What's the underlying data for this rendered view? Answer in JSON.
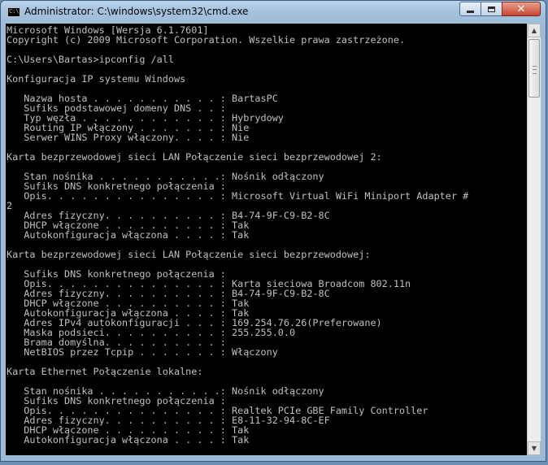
{
  "window": {
    "title": "Administrator: C:\\windows\\system32\\cmd.exe",
    "icon_text": "C:\\"
  },
  "console": {
    "lines": [
      "Microsoft Windows [Wersja 6.1.7601]",
      "Copyright (c) 2009 Microsoft Corporation. Wszelkie prawa zastrzeżone.",
      "",
      "C:\\Users\\Bartas>ipconfig /all",
      "",
      "Konfiguracja IP systemu Windows",
      "",
      "   Nazwa hosta . . . . . . . . . . . : BartasPC",
      "   Sufiks podstawowej domeny DNS . . :",
      "   Typ węzła . . . . . . . . . . . . : Hybrydowy",
      "   Routing IP włączony . . . . . . . : Nie",
      "   Serwer WINS Proxy włączony. . . . : Nie",
      "",
      "Karta bezprzewodowej sieci LAN Połączenie sieci bezprzewodowej 2:",
      "",
      "   Stan nośnika . . . . . . . . . . .: Nośnik odłączony",
      "   Sufiks DNS konkretnego połączenia :",
      "   Opis. . . . . . . . . . . . . . . : Microsoft Virtual WiFi Miniport Adapter #",
      "2",
      "   Adres fizyczny. . . . . . . . . . : B4-74-9F-C9-B2-8C",
      "   DHCP włączone . . . . . . . . . . : Tak",
      "   Autokonfiguracja włączona . . . . : Tak",
      "",
      "Karta bezprzewodowej sieci LAN Połączenie sieci bezprzewodowej:",
      "",
      "   Sufiks DNS konkretnego połączenia :",
      "   Opis. . . . . . . . . . . . . . . : Karta sieciowa Broadcom 802.11n",
      "   Adres fizyczny. . . . . . . . . . : B4-74-9F-C9-B2-8C",
      "   DHCP włączone . . . . . . . . . . : Tak",
      "   Autokonfiguracja włączona . . . . : Tak",
      "   Adres IPv4 autokonfiguracji . . . : 169.254.76.26(Preferowane)",
      "   Maska podsieci. . . . . . . . . . : 255.255.0.0",
      "   Brama domyślna. . . . . . . . . . :",
      "   NetBIOS przez Tcpip . . . . . . . : Włączony",
      "",
      "Karta Ethernet Połączenie lokalne:",
      "",
      "   Stan nośnika . . . . . . . . . . .: Nośnik odłączony",
      "   Sufiks DNS konkretnego połączenia :",
      "   Opis. . . . . . . . . . . . . . . : Realtek PCIe GBE Family Controller",
      "   Adres fizyczny. . . . . . . . . . : E8-11-32-94-8C-EF",
      "   DHCP włączone . . . . . . . . . . : Tak",
      "   Autokonfiguracja włączona . . . . : Tak"
    ]
  },
  "scrollbar": {
    "up_icon": "scroll-up-arrow-icon",
    "down_icon": "scroll-down-arrow-icon"
  },
  "colors": {
    "console_bg": "#000000",
    "console_fg": "#c0c0c0",
    "close_button": "#c8452c"
  }
}
